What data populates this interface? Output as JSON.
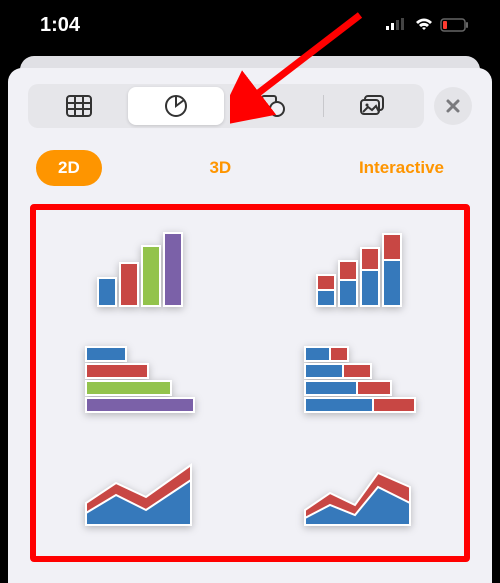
{
  "status": {
    "time": "1:04"
  },
  "segmentedTabs": {
    "table": "table-icon",
    "chart": "pie-chart-icon",
    "shape": "shapes-icon",
    "media": "media-icon"
  },
  "subTabs": {
    "twoD": "2D",
    "threeD": "3D",
    "interactive": "Interactive"
  },
  "chartOptions": {
    "colBar": "column-bar-chart",
    "stackedCol": "stacked-column-chart",
    "horizBar": "horizontal-bar-chart",
    "stackedHoriz": "stacked-horizontal-bar-chart",
    "area": "area-chart",
    "stackedArea": "stacked-area-chart"
  },
  "colors": {
    "blue": "#3679bb",
    "red": "#c84744",
    "green": "#93c34c",
    "purple": "#7b61a8",
    "accent": "#fe9500"
  }
}
